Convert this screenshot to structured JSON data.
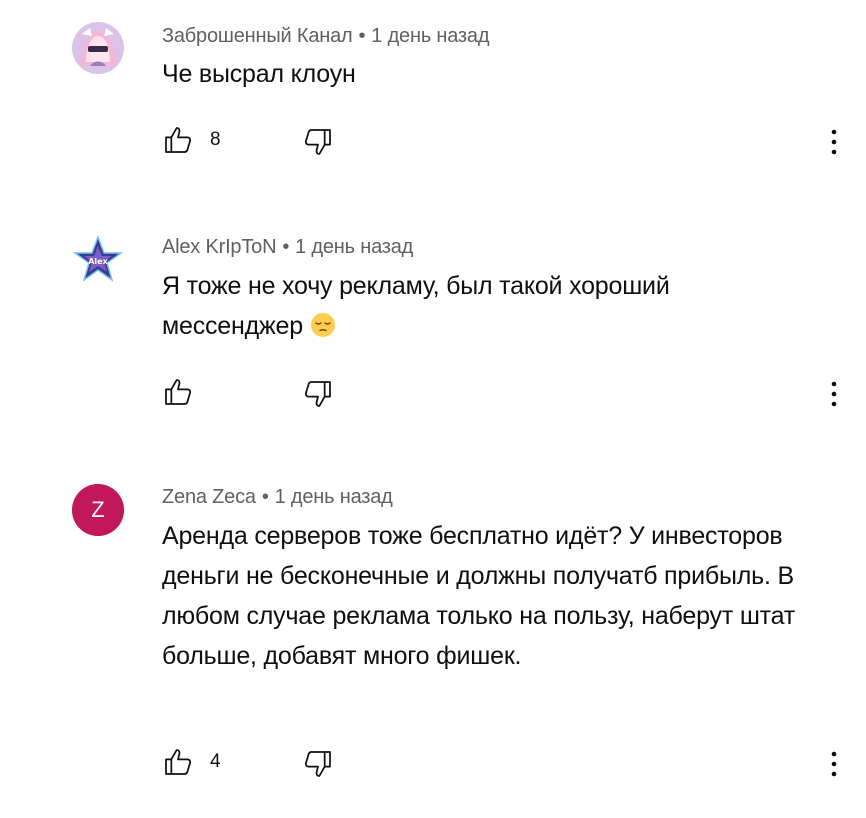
{
  "comments": [
    {
      "author": "Заброшенный Канал",
      "separator": "•",
      "time": "1 день назад",
      "text": "Че высрал клоун",
      "likes": "8",
      "avatar_icon": "anime-girl-avatar"
    },
    {
      "author": "Alex KrIpToN",
      "separator": "•",
      "time": "1 день назад",
      "text": "Я тоже не хочу рекламу, был такой хороший мессенджер",
      "emoji": "pensive-face-emoji",
      "likes": "",
      "avatar_icon": "star-avatar"
    },
    {
      "author": "Zena Zeca",
      "separator": "•",
      "time": "1 день назад",
      "text": "Аренда серверов тоже бесплатно идёт? У инвесторов деньги не бесконечные и должны получатб прибыль. В любом случае реклама только на пользу, наберут штат больше, добавят много фишек.",
      "likes": "4",
      "avatar_letter": "Z",
      "avatar_color": "#c2185b"
    }
  ],
  "colors": {
    "meta_text": "#606060",
    "body_text": "#0f0f0f",
    "icon_stroke": "#0f0f0f"
  }
}
